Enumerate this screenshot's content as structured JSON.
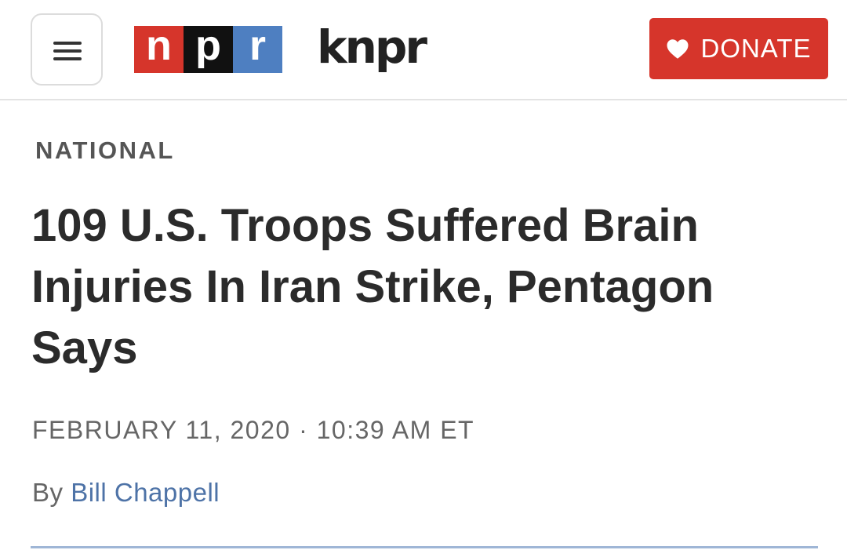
{
  "header": {
    "menu_icon": "hamburger-menu-icon",
    "npr_logo": {
      "letters": [
        "n",
        "p",
        "r"
      ],
      "colors": [
        "#d6352b",
        "#111111",
        "#4e7fc1"
      ]
    },
    "station_logo": "knpr",
    "donate": {
      "label": "DONATE",
      "icon": "heart-icon",
      "color": "#d6352b"
    }
  },
  "article": {
    "section": "NATIONAL",
    "headline": "109 U.S. Troops Suffered Brain Injuries In Iran Strike, Pentagon Says",
    "date": "FEBRUARY 11, 2020 · 10:39 AM ET",
    "byline_prefix": "By",
    "author": "Bill Chappell",
    "author_color": "#4e73a7"
  }
}
